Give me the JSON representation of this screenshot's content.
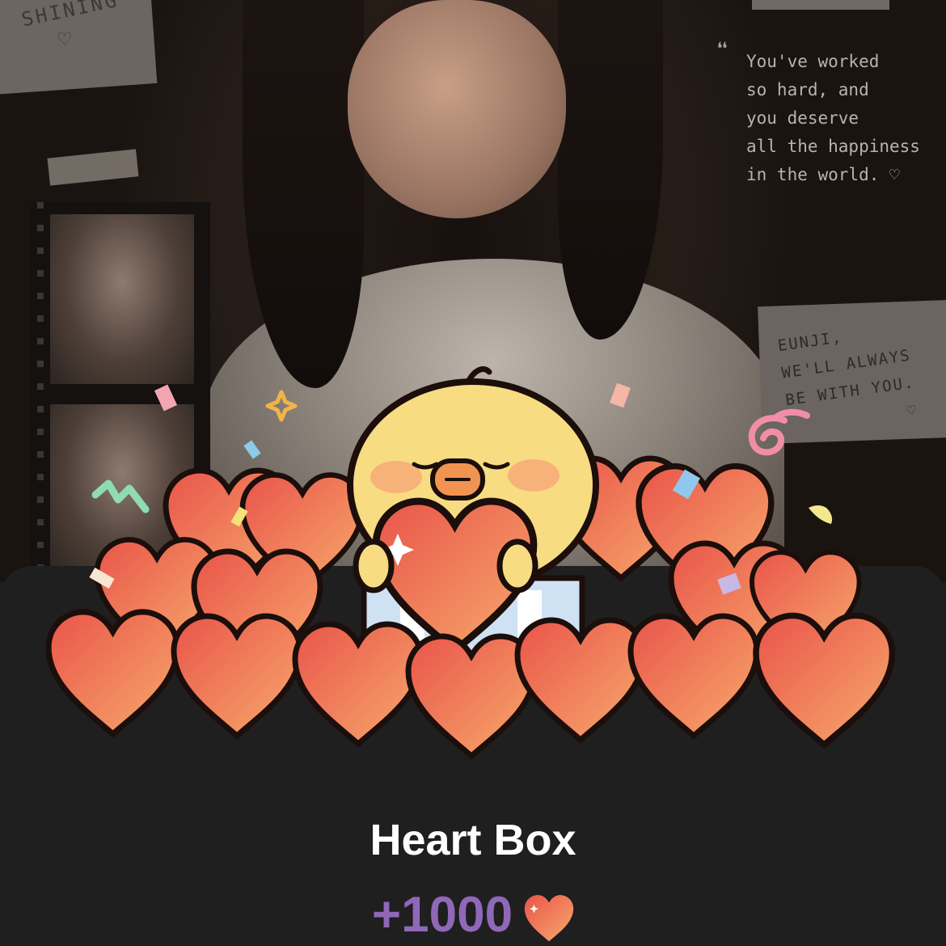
{
  "poster": {
    "corner_text": "SHINING",
    "corner_heart": "♡",
    "quote_mark": "66",
    "quote_lines": [
      "You've worked",
      "so hard, and",
      "you deserve",
      "all the happiness",
      "in the world. ♡"
    ],
    "note_lines": [
      "EUNJI,",
      "WE'LL ALWAYS",
      "BE WITH YOU.",
      "♡"
    ]
  },
  "gift": {
    "name": "Heart Box",
    "amount": "+1000",
    "amount_color": "#8f68b8",
    "icon": "heart-icon"
  },
  "colors": {
    "heart_fill_start": "#ea5a4c",
    "heart_fill_end": "#f6a56a",
    "chick": "#f7dc82",
    "sheet_bg": "#1f1f1f"
  }
}
